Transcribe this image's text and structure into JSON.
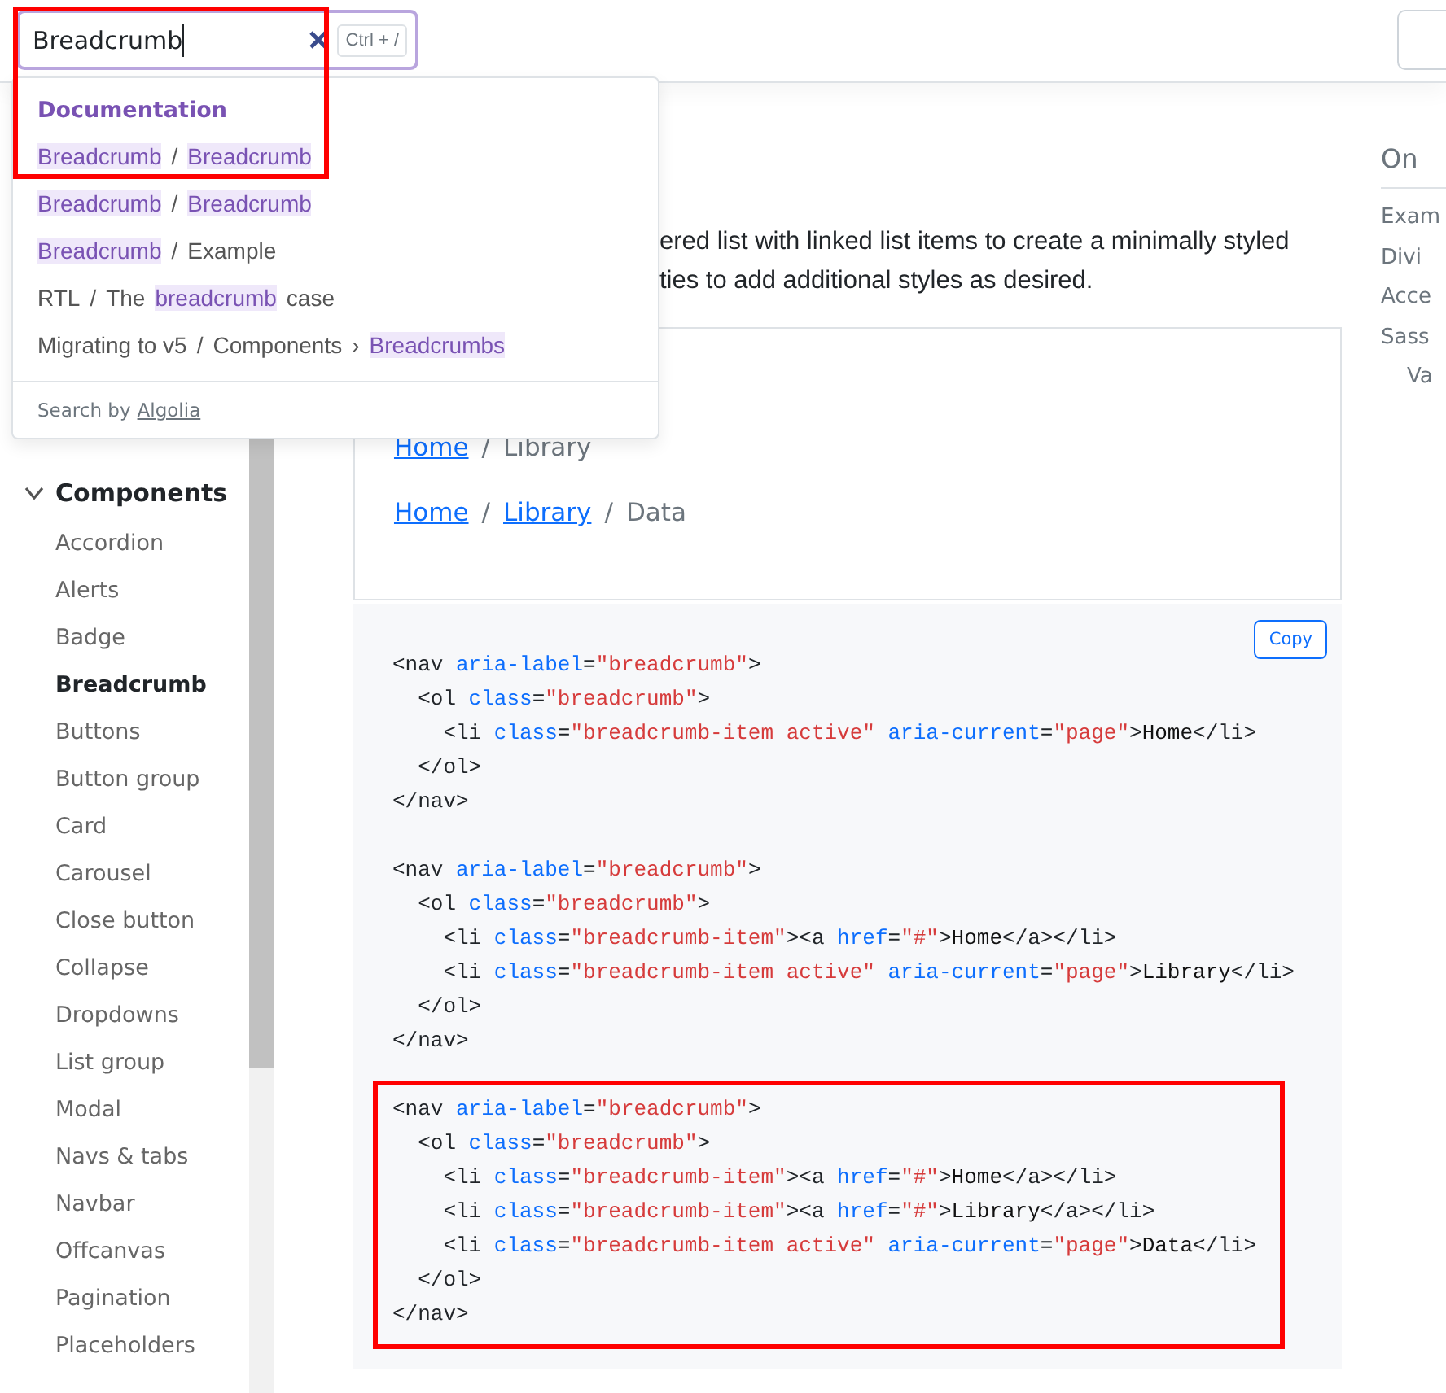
{
  "search": {
    "value": "Breadcrumb",
    "shortcut": "Ctrl + /",
    "framed": true,
    "results": {
      "section": "Documentation",
      "items": [
        {
          "segments": [
            {
              "text": "Breadcrumb",
              "match": true
            },
            {
              "text": "/",
              "match": false
            },
            {
              "text": "Breadcrumb",
              "match": true
            }
          ]
        },
        {
          "segments": [
            {
              "text": "Breadcrumb",
              "match": true
            },
            {
              "text": "/",
              "match": false
            },
            {
              "text": "Breadcrumb",
              "match": true
            }
          ]
        },
        {
          "segments": [
            {
              "text": "Breadcrumb",
              "match": true
            },
            {
              "text": "/",
              "match": false
            },
            {
              "text": "Example",
              "match": false
            }
          ]
        },
        {
          "segments": [
            {
              "text": "RTL",
              "match": false
            },
            {
              "text": "/",
              "match": false
            },
            {
              "text": "The",
              "match": false
            },
            {
              "text": "breadcrumb",
              "match": true
            },
            {
              "text": "case",
              "match": false
            }
          ]
        },
        {
          "segments": [
            {
              "text": "Migrating to v5",
              "match": false
            },
            {
              "text": "/",
              "match": false
            },
            {
              "text": "Components",
              "match": false
            },
            {
              "text": "›",
              "match": false
            },
            {
              "text": "Breadcrumbs",
              "match": true
            }
          ]
        }
      ],
      "footer": {
        "text": "Search by",
        "link": "Algolia"
      }
    }
  },
  "sidebar": {
    "groups": [
      {
        "label": "Components",
        "expanded": true,
        "items": [
          {
            "label": "Accordion",
            "selected": false
          },
          {
            "label": "Alerts",
            "selected": false
          },
          {
            "label": "Badge",
            "selected": false
          },
          {
            "label": "Breadcrumb",
            "selected": true
          },
          {
            "label": "Buttons",
            "selected": false
          },
          {
            "label": "Button group",
            "selected": false
          },
          {
            "label": "Card",
            "selected": false
          },
          {
            "label": "Carousel",
            "selected": false
          },
          {
            "label": "Close button",
            "selected": false
          },
          {
            "label": "Collapse",
            "selected": false
          },
          {
            "label": "Dropdowns",
            "selected": false
          },
          {
            "label": "List group",
            "selected": false
          },
          {
            "label": "Modal",
            "selected": false
          },
          {
            "label": "Navs & tabs",
            "selected": false
          },
          {
            "label": "Navbar",
            "selected": false
          },
          {
            "label": "Offcanvas",
            "selected": false
          },
          {
            "label": "Pagination",
            "selected": false
          },
          {
            "label": "Placeholders",
            "selected": false
          }
        ]
      }
    ]
  },
  "intro": [
    "ered list with linked list items to create a minimally styled",
    "ties to add additional styles as desired."
  ],
  "example": {
    "separator": "/",
    "breadcrumbs": [
      [
        {
          "text": "Home",
          "link": true
        },
        {
          "text": "Library",
          "link": false
        }
      ],
      [
        {
          "text": "Home",
          "link": true
        },
        {
          "text": "Library",
          "link": true
        },
        {
          "text": "Data",
          "link": false
        }
      ]
    ]
  },
  "copy_button": "Copy",
  "code_blocks": [
    {
      "framed": false,
      "lines": [
        [
          {
            "text": "<nav",
            "kind": "tag"
          },
          {
            "text": " aria-label",
            "kind": "attribute"
          },
          {
            "text": "=",
            "kind": "tag"
          },
          {
            "text": "\"breadcrumb\"",
            "kind": "string"
          },
          {
            "text": ">",
            "kind": "tag"
          }
        ],
        [
          {
            "text": "  <ol",
            "kind": "tag"
          },
          {
            "text": " class",
            "kind": "attribute"
          },
          {
            "text": "=",
            "kind": "tag"
          },
          {
            "text": "\"breadcrumb\"",
            "kind": "string"
          },
          {
            "text": ">",
            "kind": "tag"
          }
        ],
        [
          {
            "text": "    <li",
            "kind": "tag"
          },
          {
            "text": " class",
            "kind": "attribute"
          },
          {
            "text": "=",
            "kind": "tag"
          },
          {
            "text": "\"breadcrumb-item active\"",
            "kind": "string"
          },
          {
            "text": " aria-current",
            "kind": "attribute"
          },
          {
            "text": "=",
            "kind": "tag"
          },
          {
            "text": "\"page\"",
            "kind": "string"
          },
          {
            "text": ">",
            "kind": "tag"
          },
          {
            "text": "Home",
            "kind": "text"
          },
          {
            "text": "</li>",
            "kind": "tag"
          }
        ],
        [
          {
            "text": "  </ol>",
            "kind": "tag"
          }
        ],
        [
          {
            "text": "</nav>",
            "kind": "tag"
          }
        ]
      ]
    },
    {
      "framed": false,
      "lines": [
        [
          {
            "text": "<nav",
            "kind": "tag"
          },
          {
            "text": " aria-label",
            "kind": "attribute"
          },
          {
            "text": "=",
            "kind": "tag"
          },
          {
            "text": "\"breadcrumb\"",
            "kind": "string"
          },
          {
            "text": ">",
            "kind": "tag"
          }
        ],
        [
          {
            "text": "  <ol",
            "kind": "tag"
          },
          {
            "text": " class",
            "kind": "attribute"
          },
          {
            "text": "=",
            "kind": "tag"
          },
          {
            "text": "\"breadcrumb\"",
            "kind": "string"
          },
          {
            "text": ">",
            "kind": "tag"
          }
        ],
        [
          {
            "text": "    <li",
            "kind": "tag"
          },
          {
            "text": " class",
            "kind": "attribute"
          },
          {
            "text": "=",
            "kind": "tag"
          },
          {
            "text": "\"breadcrumb-item\"",
            "kind": "string"
          },
          {
            "text": "><a",
            "kind": "tag"
          },
          {
            "text": " href",
            "kind": "attribute"
          },
          {
            "text": "=",
            "kind": "tag"
          },
          {
            "text": "\"#\"",
            "kind": "string"
          },
          {
            "text": ">",
            "kind": "tag"
          },
          {
            "text": "Home",
            "kind": "text"
          },
          {
            "text": "</a></li>",
            "kind": "tag"
          }
        ],
        [
          {
            "text": "    <li",
            "kind": "tag"
          },
          {
            "text": " class",
            "kind": "attribute"
          },
          {
            "text": "=",
            "kind": "tag"
          },
          {
            "text": "\"breadcrumb-item active\"",
            "kind": "string"
          },
          {
            "text": " aria-current",
            "kind": "attribute"
          },
          {
            "text": "=",
            "kind": "tag"
          },
          {
            "text": "\"page\"",
            "kind": "string"
          },
          {
            "text": ">",
            "kind": "tag"
          },
          {
            "text": "Library",
            "kind": "text"
          },
          {
            "text": "</li>",
            "kind": "tag"
          }
        ],
        [
          {
            "text": "  </ol>",
            "kind": "tag"
          }
        ],
        [
          {
            "text": "</nav>",
            "kind": "tag"
          }
        ]
      ]
    },
    {
      "framed": true,
      "lines": [
        [
          {
            "text": "<nav",
            "kind": "tag"
          },
          {
            "text": " aria-label",
            "kind": "attribute"
          },
          {
            "text": "=",
            "kind": "tag"
          },
          {
            "text": "\"breadcrumb\"",
            "kind": "string"
          },
          {
            "text": ">",
            "kind": "tag"
          }
        ],
        [
          {
            "text": "  <ol",
            "kind": "tag"
          },
          {
            "text": " class",
            "kind": "attribute"
          },
          {
            "text": "=",
            "kind": "tag"
          },
          {
            "text": "\"breadcrumb\"",
            "kind": "string"
          },
          {
            "text": ">",
            "kind": "tag"
          }
        ],
        [
          {
            "text": "    <li",
            "kind": "tag"
          },
          {
            "text": " class",
            "kind": "attribute"
          },
          {
            "text": "=",
            "kind": "tag"
          },
          {
            "text": "\"breadcrumb-item\"",
            "kind": "string"
          },
          {
            "text": "><a",
            "kind": "tag"
          },
          {
            "text": " href",
            "kind": "attribute"
          },
          {
            "text": "=",
            "kind": "tag"
          },
          {
            "text": "\"#\"",
            "kind": "string"
          },
          {
            "text": ">",
            "kind": "tag"
          },
          {
            "text": "Home",
            "kind": "text"
          },
          {
            "text": "</a></li>",
            "kind": "tag"
          }
        ],
        [
          {
            "text": "    <li",
            "kind": "tag"
          },
          {
            "text": " class",
            "kind": "attribute"
          },
          {
            "text": "=",
            "kind": "tag"
          },
          {
            "text": "\"breadcrumb-item\"",
            "kind": "string"
          },
          {
            "text": "><a",
            "kind": "tag"
          },
          {
            "text": " href",
            "kind": "attribute"
          },
          {
            "text": "=",
            "kind": "tag"
          },
          {
            "text": "\"#\"",
            "kind": "string"
          },
          {
            "text": ">",
            "kind": "tag"
          },
          {
            "text": "Library",
            "kind": "text"
          },
          {
            "text": "</a></li>",
            "kind": "tag"
          }
        ],
        [
          {
            "text": "    <li",
            "kind": "tag"
          },
          {
            "text": " class",
            "kind": "attribute"
          },
          {
            "text": "=",
            "kind": "tag"
          },
          {
            "text": "\"breadcrumb-item active\"",
            "kind": "string"
          },
          {
            "text": " aria-current",
            "kind": "attribute"
          },
          {
            "text": "=",
            "kind": "tag"
          },
          {
            "text": "\"page\"",
            "kind": "string"
          },
          {
            "text": ">",
            "kind": "tag"
          },
          {
            "text": "Data",
            "kind": "text"
          },
          {
            "text": "</li>",
            "kind": "tag"
          }
        ],
        [
          {
            "text": "  </ol>",
            "kind": "tag"
          }
        ],
        [
          {
            "text": "</nav>",
            "kind": "tag"
          }
        ]
      ]
    }
  ],
  "toc": {
    "title": "On",
    "items": [
      {
        "label": "Exam",
        "nested": false
      },
      {
        "label": "Divi",
        "nested": false
      },
      {
        "label": "Acce",
        "nested": false
      },
      {
        "label": "Sass",
        "nested": false
      },
      {
        "label": "Va",
        "nested": true
      }
    ]
  }
}
